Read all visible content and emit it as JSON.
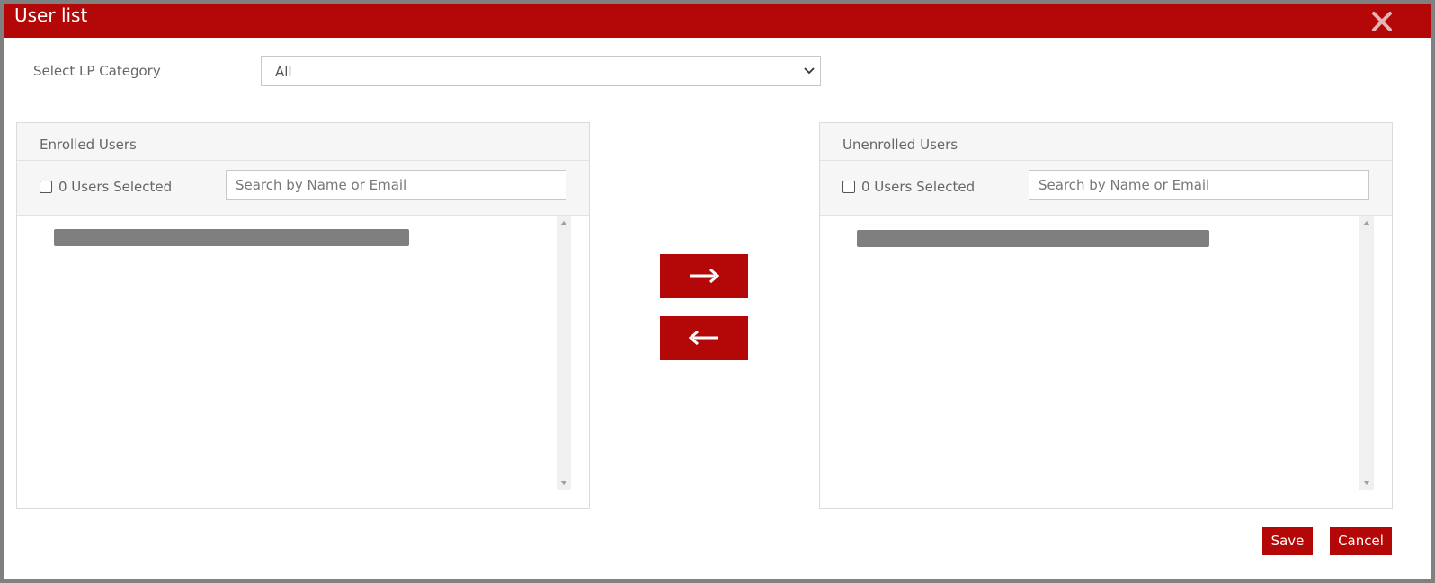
{
  "dialog": {
    "title": "User list",
    "close_icon": "close-icon"
  },
  "category": {
    "label": "Select LP Category",
    "selected": "All"
  },
  "enrolled": {
    "title": "Enrolled Users",
    "selected_count": "0 Users Selected",
    "search_placeholder": "Search by Name or Email"
  },
  "unenrolled": {
    "title": "Unenrolled Users",
    "selected_count": "0 Users Selected",
    "search_placeholder": "Search by Name or Email"
  },
  "actions": {
    "enroll_icon": "arrow-right-icon",
    "unenroll_icon": "arrow-left-icon"
  },
  "footer": {
    "save_label": "Save",
    "cancel_label": "Cancel"
  },
  "colors": {
    "accent": "#b40808",
    "overlay": "#808080",
    "redacted": "#7f7f7f"
  }
}
